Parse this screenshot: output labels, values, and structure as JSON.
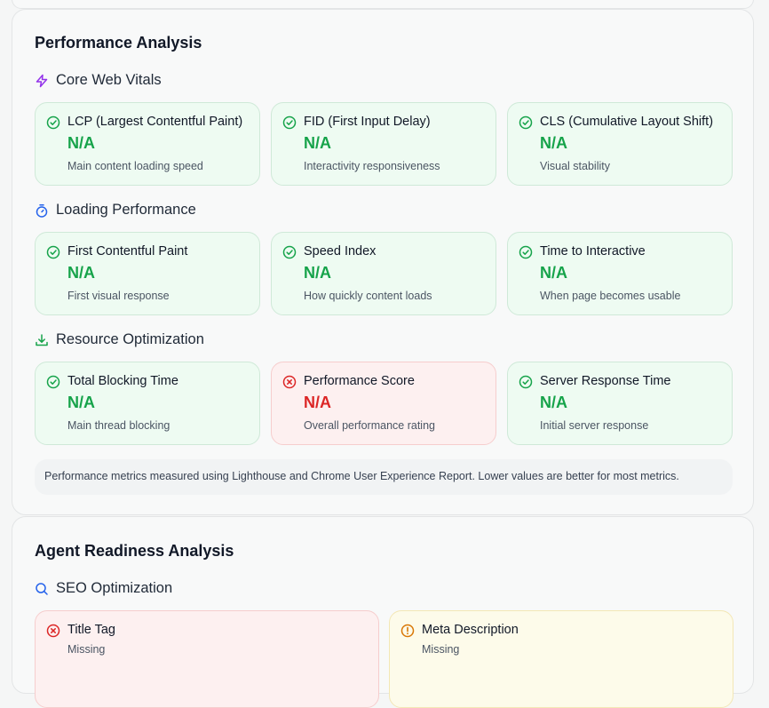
{
  "performance": {
    "title": "Performance Analysis",
    "groups": [
      {
        "title": "Core Web Vitals",
        "icon": "lightning-icon",
        "metrics": [
          {
            "title": "LCP (Largest Contentful Paint)",
            "value": "N/A",
            "desc": "Main content loading speed",
            "status": "pass"
          },
          {
            "title": "FID (First Input Delay)",
            "value": "N/A",
            "desc": "Interactivity responsiveness",
            "status": "pass"
          },
          {
            "title": "CLS (Cumulative Layout Shift)",
            "value": "N/A",
            "desc": "Visual stability",
            "status": "pass"
          }
        ]
      },
      {
        "title": "Loading Performance",
        "icon": "stopwatch-icon",
        "metrics": [
          {
            "title": "First Contentful Paint",
            "value": "N/A",
            "desc": "First visual response",
            "status": "pass"
          },
          {
            "title": "Speed Index",
            "value": "N/A",
            "desc": "How quickly content loads",
            "status": "pass"
          },
          {
            "title": "Time to Interactive",
            "value": "N/A",
            "desc": "When page becomes usable",
            "status": "pass"
          }
        ]
      },
      {
        "title": "Resource Optimization",
        "icon": "download-icon",
        "metrics": [
          {
            "title": "Total Blocking Time",
            "value": "N/A",
            "desc": "Main thread blocking",
            "status": "pass"
          },
          {
            "title": "Performance Score",
            "value": "N/A",
            "desc": "Overall performance rating",
            "status": "fail"
          },
          {
            "title": "Server Response Time",
            "value": "N/A",
            "desc": "Initial server response",
            "status": "pass"
          }
        ]
      }
    ],
    "note": "Performance metrics measured using Lighthouse and Chrome User Experience Report. Lower values are better for most metrics."
  },
  "agent": {
    "title": "Agent Readiness Analysis",
    "groups": [
      {
        "title": "SEO Optimization",
        "icon": "search-icon",
        "checks": [
          {
            "title": "Title Tag",
            "value": "Missing",
            "status": "fail"
          },
          {
            "title": "Meta Description",
            "value": "Missing",
            "status": "warn"
          }
        ]
      }
    ]
  },
  "colors": {
    "pass": "#16a34a",
    "fail": "#dc2626",
    "warn": "#d97706",
    "purple": "#9333ea",
    "blue": "#2563eb"
  }
}
